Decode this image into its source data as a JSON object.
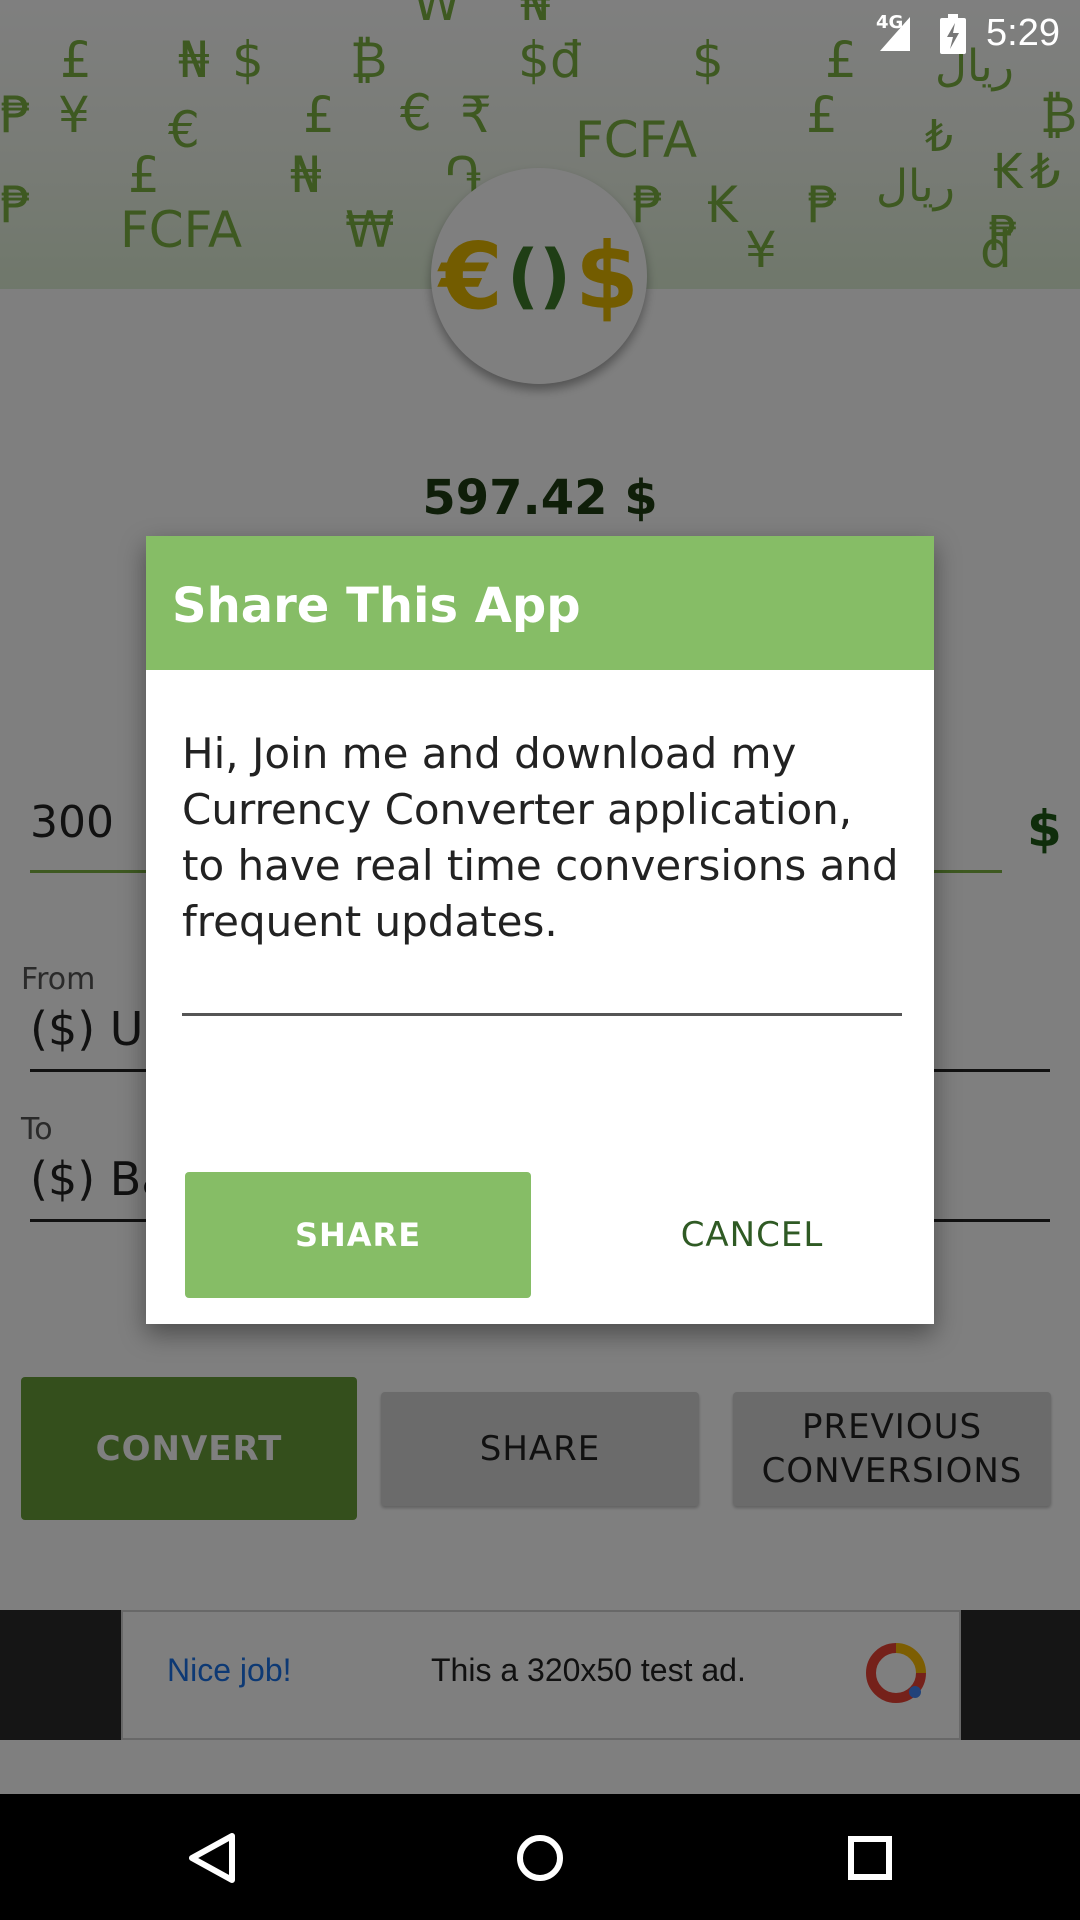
{
  "status_bar": {
    "network": "4G",
    "time": "5:29"
  },
  "header": {
    "currency_symbols": [
      "₩",
      "₦",
      "£",
      "₦",
      "$",
      "₿",
      "$",
      "đ",
      "$",
      "£",
      "ريال",
      "₱",
      "¥",
      "€",
      "£",
      "€",
      "₹",
      "FCFA",
      "£",
      "₺",
      "₿",
      "₱",
      "£",
      "₦",
      "֏",
      "₱",
      "₭",
      "₱",
      "ريال",
      "₭",
      "₺",
      "₱",
      "FCFA",
      "₩",
      "¥",
      "đ"
    ],
    "logo": {
      "left_symbol": "€",
      "middle_symbol": "()",
      "right_symbol": "$"
    }
  },
  "result": {
    "value": "597.42",
    "currency": "$"
  },
  "amount": {
    "value": "300",
    "currency_symbol": "$"
  },
  "from": {
    "label": "From",
    "value": "($) Un"
  },
  "to": {
    "label": "To",
    "value": "($) Ba"
  },
  "buttons": {
    "convert": "CONVERT",
    "share": "SHARE",
    "previous_line1": "PREVIOUS",
    "previous_line2": "CONVERSIONS"
  },
  "ad": {
    "nice": "Nice job!",
    "text": "This a 320x50 test ad."
  },
  "dialog": {
    "title": "Share This App",
    "message": "Hi, Join me and download my Currency Converter application, to have real time conversions and frequent updates.",
    "share_label": "SHARE",
    "cancel_label": "CANCEL"
  },
  "colors": {
    "accent_green": "#86bd66",
    "dark_green": "#689f38",
    "currency_symbol_green": "#7cb342"
  },
  "nav_icons": [
    "back-icon",
    "home-icon",
    "recents-icon"
  ]
}
